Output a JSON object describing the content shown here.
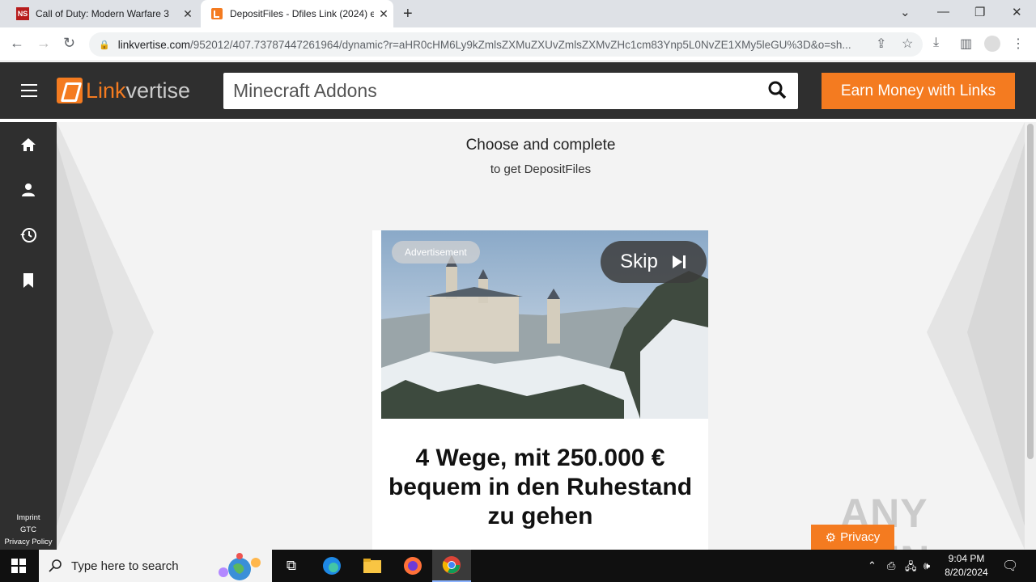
{
  "browser": {
    "tabs": [
      {
        "title": "Call of Duty: Modern Warfare 3",
        "favicon": "ns-favicon",
        "favicon_text": "NS"
      },
      {
        "title": "DepositFiles - Dfiles Link (2024) e",
        "favicon": "linkvertise-favicon"
      }
    ],
    "url_domain": "linkvertise.com",
    "url_path": "/952012/407.73787447261964/dynamic?r=aHR0cHM6Ly9kZmlsZXMuZXUvZmlsZXMvZHc1cm83Ynp5L0NvZE1XMy5leGU%3D&o=sh..."
  },
  "header": {
    "logo_part1": "Link",
    "logo_part2": "vertise",
    "search_text": "Minecraft Addons",
    "earn_button": "Earn Money with Links"
  },
  "sidebar": {
    "icons": [
      "home-icon",
      "user-icon",
      "history-icon",
      "bookmark-icon"
    ],
    "footer": [
      "Imprint",
      "GTC",
      "Privacy Policy"
    ]
  },
  "main": {
    "title": "Choose and complete",
    "subtitle": "to get DepositFiles",
    "ad": {
      "label": "Advertisement",
      "skip_label": "Skip",
      "headline": "4 Wege, mit 250.000 € bequem in den Ruhestand zu gehen"
    },
    "privacy_button": "Privacy",
    "watermark": "ANY RUN"
  },
  "taskbar": {
    "search_placeholder": "Type here to search",
    "time": "9:04 PM",
    "date": "8/20/2024"
  },
  "colors": {
    "accent": "#f47b20",
    "header_bg": "#2f2f2f",
    "main_bg": "#f3f3f3"
  }
}
